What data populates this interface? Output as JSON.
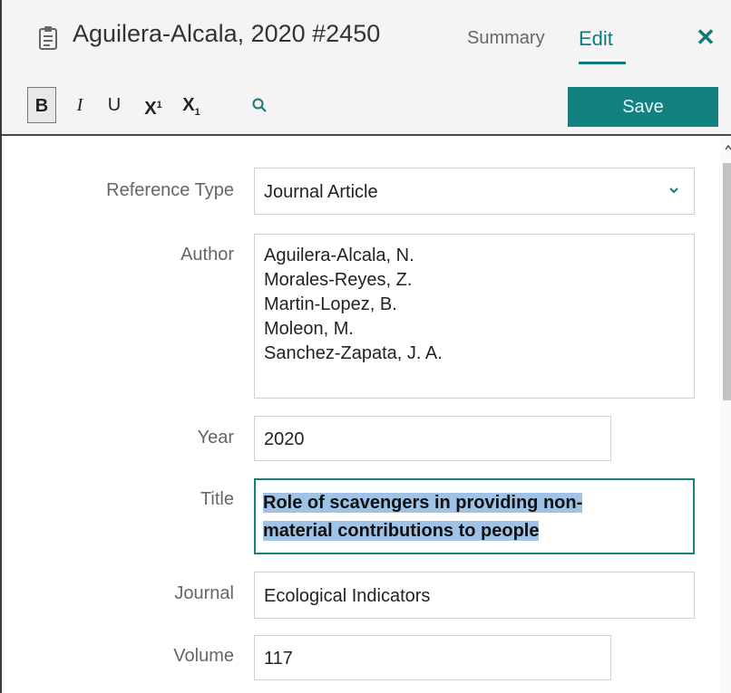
{
  "header": {
    "reference_title": "Aguilera-Alcala, 2020 #2450",
    "tabs": [
      {
        "label": "Summary",
        "active": false
      },
      {
        "label": "Edit",
        "active": true
      }
    ],
    "close_label": "✕",
    "accent_color": "#0f7a7a"
  },
  "toolbar": {
    "bold": "B",
    "italic": "I",
    "underline": "U",
    "superscript": "X",
    "superscript_mark": "1",
    "subscript": "X",
    "subscript_mark": "1",
    "search_icon": "search-icon",
    "save_label": "Save"
  },
  "form": {
    "reference_type": {
      "label": "Reference Type",
      "value": "Journal Article"
    },
    "author": {
      "label": "Author",
      "values": [
        "Aguilera-Alcala, N.",
        "Morales-Reyes, Z.",
        "Martin-Lopez, B.",
        "Moleon, M.",
        "Sanchez-Zapata, J. A."
      ]
    },
    "year": {
      "label": "Year",
      "value": "2020"
    },
    "title": {
      "label": "Title",
      "value": "Role of scavengers in providing non-material contributions to people",
      "line1": "Role of scavengers in providing non-",
      "line2": "material contributions to people"
    },
    "journal": {
      "label": "Journal",
      "value": "Ecological Indicators"
    },
    "volume": {
      "label": "Volume",
      "value": "117"
    }
  }
}
